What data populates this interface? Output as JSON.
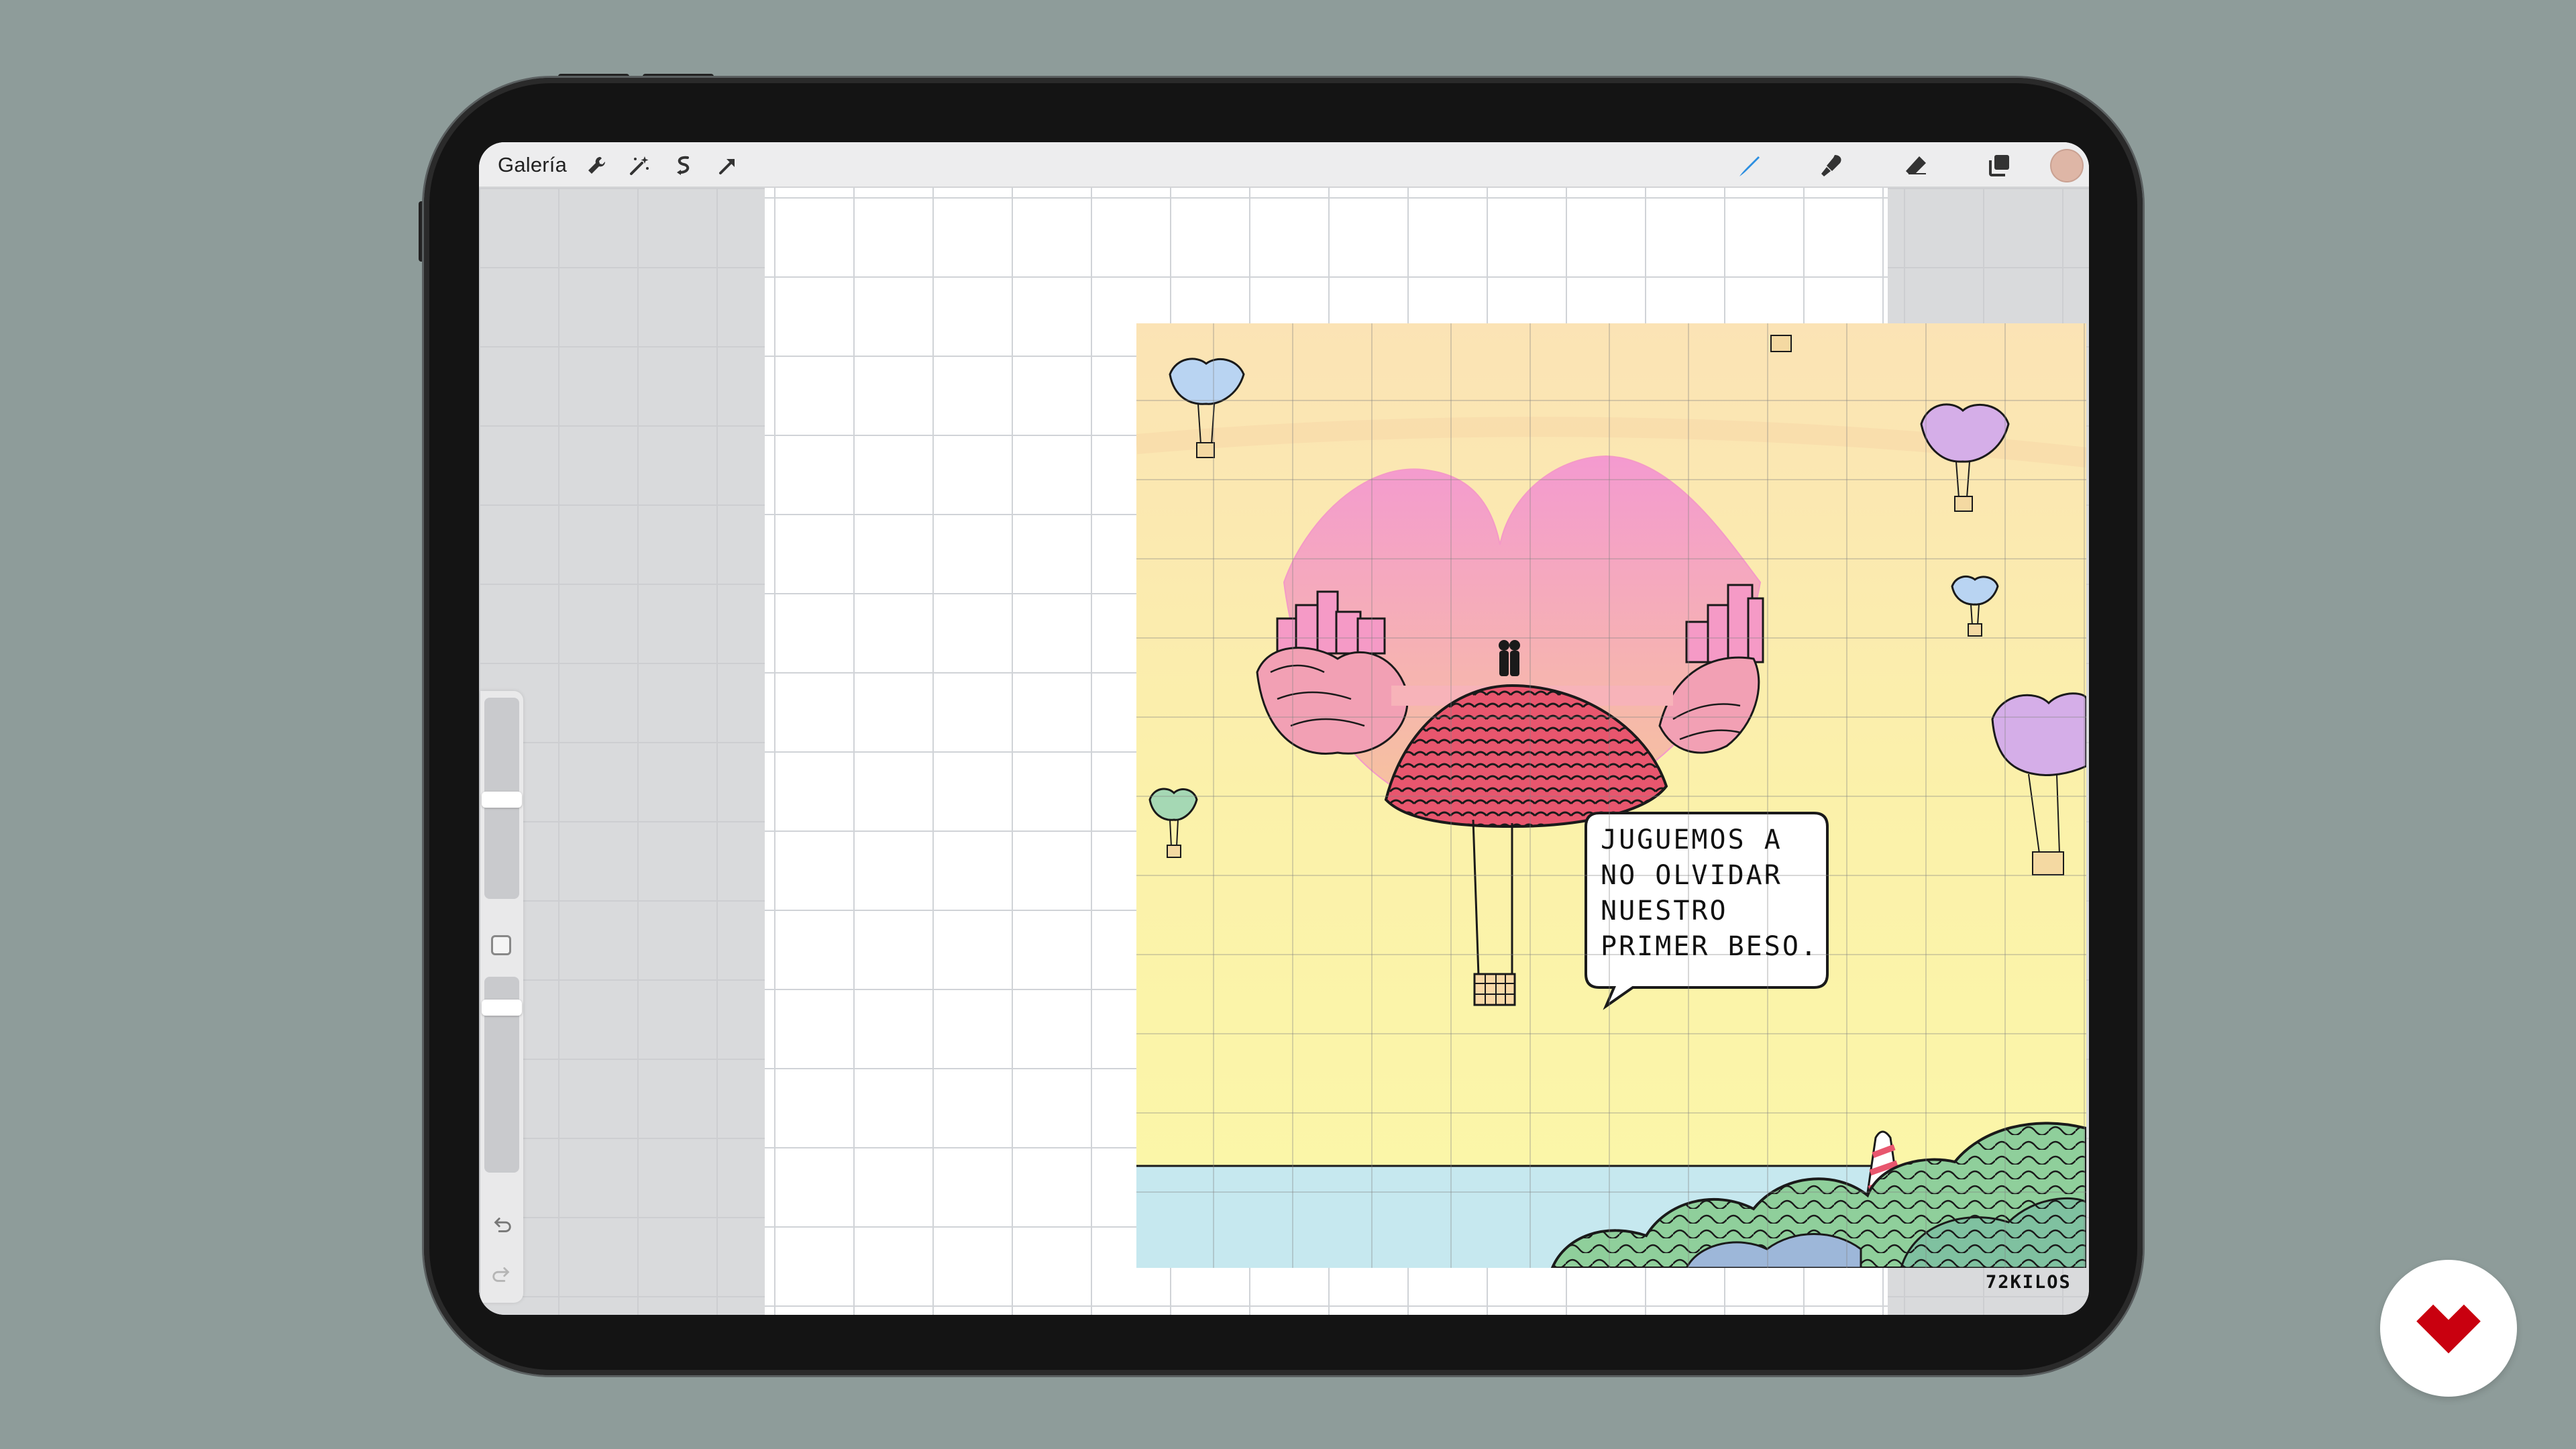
{
  "toolbar": {
    "gallery_label": "Galería",
    "left_tools": [
      "wrench-icon",
      "magic-wand-icon",
      "selection-icon",
      "transform-arrow-icon"
    ],
    "right_tools": [
      "brush-icon",
      "smudge-icon",
      "eraser-icon",
      "layers-icon"
    ],
    "active_tool": "brush-icon",
    "current_color": "#deb6a6"
  },
  "sidebar": {
    "size_slider_level": 0.5,
    "opacity_slider_level": 0.1
  },
  "artwork": {
    "speech_bubble": "JUGUEMOS A\nNO OLVIDAR\nNUESTRO\nPRIMER BESO.",
    "signature": "72KILOS"
  },
  "colors": {
    "accent": "#2d8fe0",
    "lips_pink": "#f49ac7",
    "hill_red": "#e8566e",
    "sea": "#c6e8ef",
    "sky_top": "#fbe3b5",
    "sky_bottom": "#fbf7a8"
  },
  "brand": {
    "icon": "brand-logo-icon",
    "color": "#c9000f"
  }
}
